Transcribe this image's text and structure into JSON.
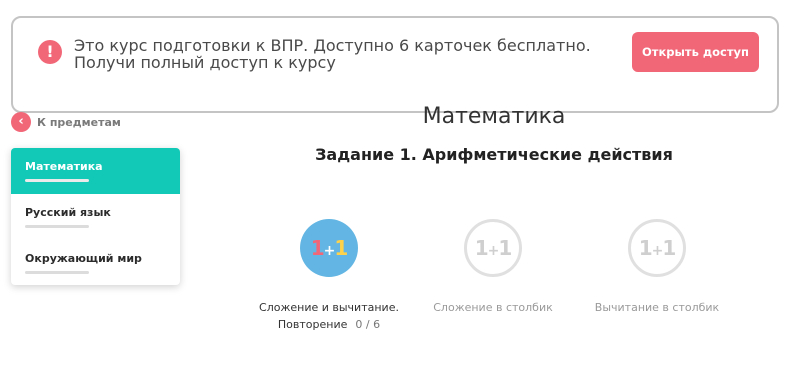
{
  "banner": {
    "icon": "exclamation-icon",
    "icon_glyph": "!",
    "line1": "Это курс подготовки к ВПР. Доступно 6 карточек бесплатно.",
    "line2": "Получи полный доступ к курсу",
    "button_label": "Открыть доступ"
  },
  "nav": {
    "back_icon": "chevron-left-icon",
    "back_glyph": "‹",
    "back_label": "К предметам"
  },
  "sidebar": {
    "items": [
      {
        "label": "Математика",
        "active": true
      },
      {
        "label": "Русский язык",
        "active": false
      },
      {
        "label": "Окружающий мир",
        "active": false
      }
    ]
  },
  "main": {
    "title": "Математика",
    "task_title": "Задание 1. Арифметические действия",
    "lessons": [
      {
        "icon": "one-plus-one-icon",
        "glyph": [
          "1",
          "+",
          "1"
        ],
        "line1": "Сложение и вычитание.",
        "line2": "Повторение",
        "progress": "0 / 6",
        "state": "active"
      },
      {
        "icon": "one-plus-one-icon",
        "glyph": [
          "1",
          "+",
          "1"
        ],
        "line1": "Сложение в столбик",
        "state": "locked"
      },
      {
        "icon": "one-plus-one-icon",
        "glyph": [
          "1",
          "+",
          "1"
        ],
        "line1": "Вычитание в столбик",
        "state": "locked"
      }
    ]
  },
  "colors": {
    "accent": "#f26778",
    "active_tab": "#11c9b6",
    "lesson_active": "#63b6e3",
    "locked_gray": "#e0e0e0"
  }
}
